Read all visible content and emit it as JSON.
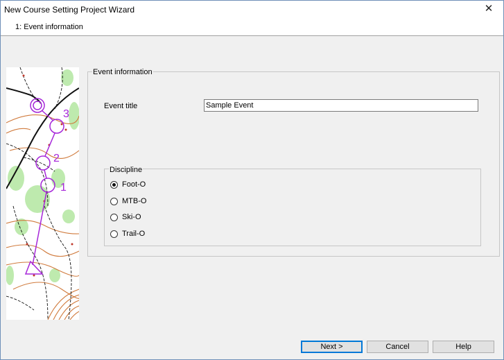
{
  "window": {
    "title": "New Course Setting Project Wizard",
    "subtitle": "1: Event information",
    "close_glyph": "✕"
  },
  "event_group": {
    "legend": "Event information",
    "title_label": "Event title",
    "title_value": "Sample Event"
  },
  "discipline": {
    "legend": "Discipline",
    "options": [
      {
        "label": "Foot-O",
        "checked": true
      },
      {
        "label": "MTB-O",
        "checked": false
      },
      {
        "label": "Ski-O",
        "checked": false
      },
      {
        "label": "Trail-O",
        "checked": false
      }
    ]
  },
  "map": {
    "control_numbers": [
      "1",
      "2",
      "3"
    ]
  },
  "buttons": {
    "next": "Next  >",
    "cancel": "Cancel",
    "help": "Help"
  },
  "colors": {
    "course_purple": "#a626d9",
    "accent_blue": "#0078d7"
  }
}
